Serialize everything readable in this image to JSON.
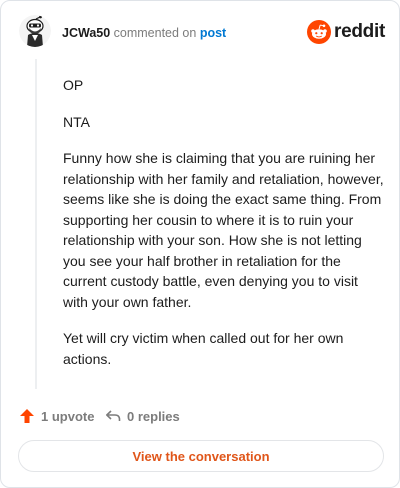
{
  "header": {
    "username": "JCWa50",
    "action_text": "commented on",
    "post_link": "post",
    "brand": "reddit",
    "avatar_icon": "snoo-avatar-icon",
    "logo_icon": "reddit-alien-icon",
    "brand_color": "#ff4500",
    "link_color": "#0079d3"
  },
  "comment": {
    "paragraphs": [
      "OP",
      "NTA",
      "Funny how she is claiming that you are ruining her relationship with her family and retaliation, however, seems like she is doing the exact same thing. From supporting her cousin to where it is to ruin your relationship with your son. How she is not letting you see your half brother in retaliation for the current custody battle, even denying you to visit with your own father.",
      "Yet will cry victim when called out for her own actions."
    ]
  },
  "actions": {
    "upvote_label": "1 upvote",
    "upvote_icon": "upvote-arrow-icon",
    "replies_label": "0 replies",
    "replies_icon": "reply-arrow-icon"
  },
  "cta": {
    "label": "View the conversation",
    "color": "#e0561a"
  }
}
